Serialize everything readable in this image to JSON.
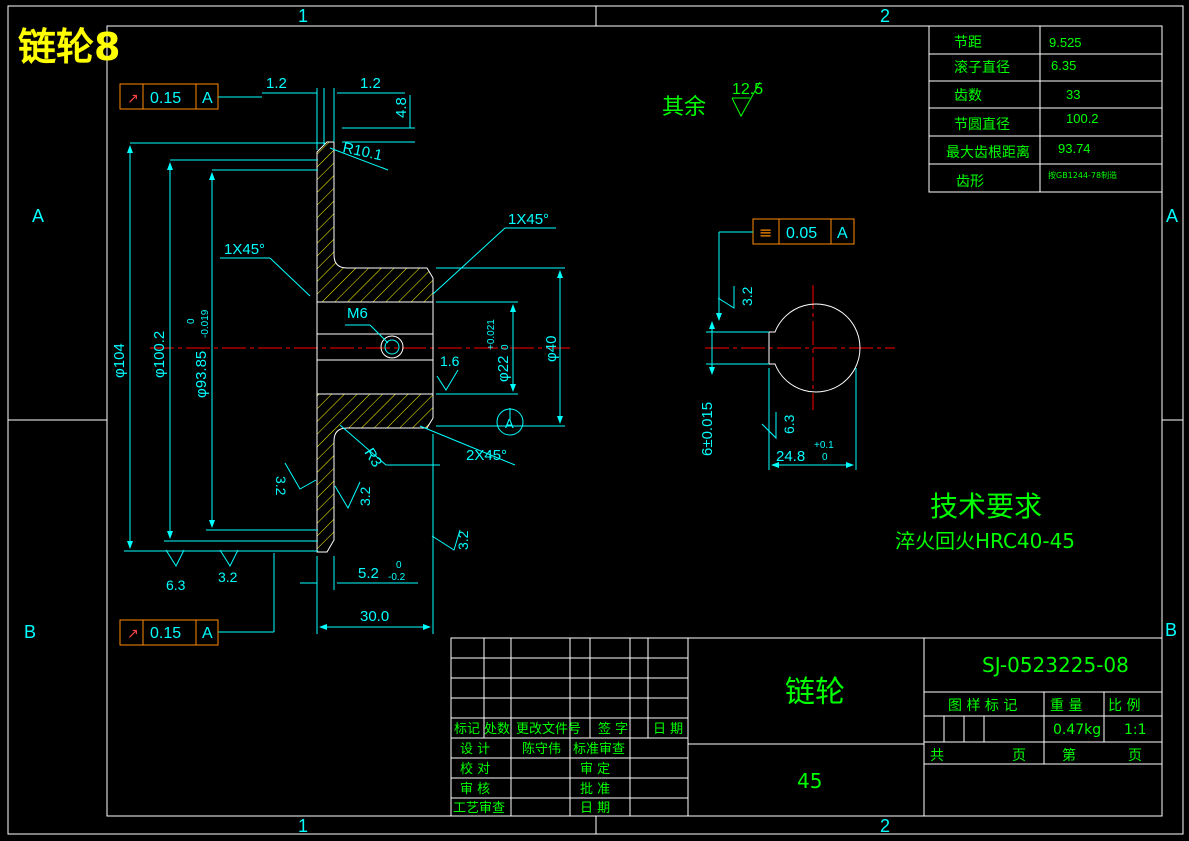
{
  "title": "链轮8",
  "zones": {
    "col1": "1",
    "col2": "2",
    "rowA": "A",
    "rowB": "B"
  },
  "colors": {
    "background": "#000000",
    "border": "#ffffff",
    "dimension": "#00ffff",
    "text_green": "#00ff00",
    "table": "#ffffff",
    "frame_box": "#ff8c00",
    "centerline": "#ff0000",
    "hatch": "#ffff00"
  },
  "param_table": {
    "rows": [
      {
        "label": "节距",
        "value": "9.525"
      },
      {
        "label": "滚子直径",
        "value": "6.35"
      },
      {
        "label": "齿数",
        "value": "33"
      },
      {
        "label": "节圆直径",
        "value": "100.2"
      },
      {
        "label": "最大齿根距离",
        "value": "93.74"
      },
      {
        "label": "齿形",
        "value": "按GB1244-78制造"
      }
    ]
  },
  "roughness_rest": {
    "label": "其余",
    "value": "12.5"
  },
  "tolerance_frames": [
    {
      "symbol": "↗",
      "value": "0.15",
      "datum": "A"
    },
    {
      "symbol": "↗",
      "value": "0.15",
      "datum": "A"
    },
    {
      "symbol": "≡",
      "value": "0.05",
      "datum": "A"
    }
  ],
  "dimensions": {
    "top_a": "1.2",
    "top_b": "1.2",
    "top_h": "4.8",
    "r10": "R10.1",
    "chamfer_a": "1X45°",
    "chamfer_b": "1X45°",
    "chamfer_c": "2X45°",
    "thread": "M6",
    "d104": "φ104",
    "d100": "φ100.2",
    "d93": "φ93.85",
    "d93_tol_up": "0",
    "d93_tol_low": "-0.019",
    "d22": "φ22",
    "d22_tol_up": "+0.021",
    "d22_tol_low": "0",
    "d40": "φ40",
    "r3": "R3",
    "w52": "5.2",
    "w52_tol_up": "0",
    "w52_tol_low": "-0.2",
    "w30": "30.0",
    "datum": "A",
    "ra": [
      "1.6",
      "3.2",
      "3.2",
      "3.2",
      "6.3",
      "3.2",
      "3.2",
      "6.3"
    ],
    "key_w": "6±0.015",
    "key_d": "24.8",
    "key_d_tol_up": "+0.1",
    "key_d_tol_low": "0"
  },
  "requirements": {
    "heading": "技术要求",
    "line1": "淬火回火HRC40-45"
  },
  "title_block": {
    "drawing_no": "SJ-0523225-08",
    "part_name": "链轮",
    "material": "45",
    "stage_label": "图 样 标 记",
    "weight_label": "重 量",
    "scale_label": "比 例",
    "weight": "0.47kg",
    "scale": "1:1",
    "total": "共",
    "page_unit": "页",
    "sheet": "第",
    "page_unit2": "页",
    "rev_header": [
      "标记",
      "处数",
      "更改文件号",
      "签 字",
      "日 期"
    ],
    "design": "设 计",
    "designer": "陈守伟",
    "std_check": "标准审查",
    "proof": "校 对",
    "review": "审 定",
    "audit": "审 核",
    "approve": "批 准",
    "process": "工艺审查",
    "date": "日 期"
  }
}
